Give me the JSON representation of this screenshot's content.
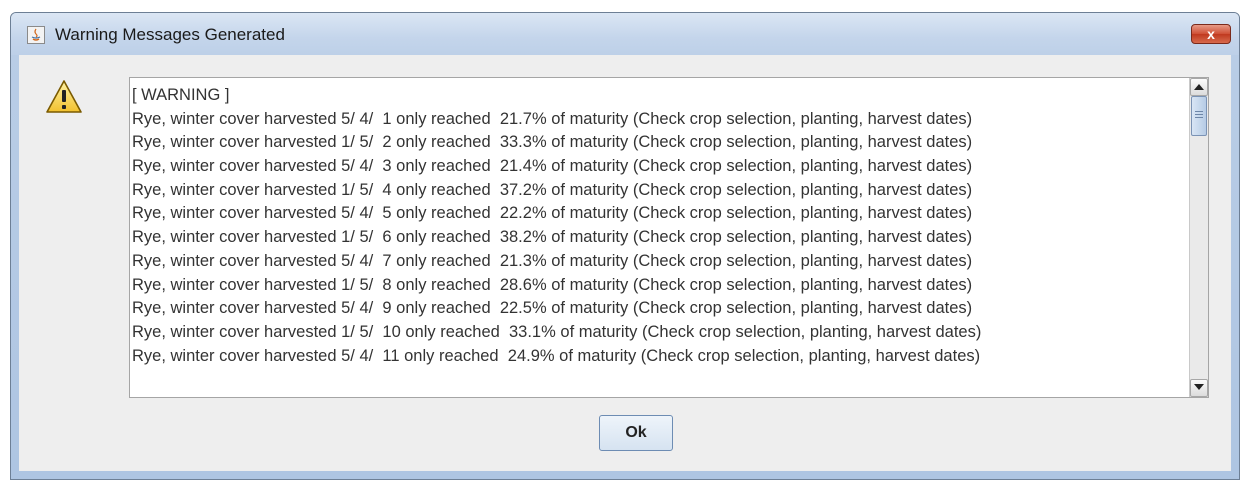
{
  "window": {
    "title": "Warning Messages Generated",
    "close_label": "x",
    "app_icon": "java-icon",
    "dialog_icon": "warning-icon"
  },
  "messages": {
    "header": "[ WARNING ]",
    "lines": [
      {
        "crop": "Rye, winter cover harvested",
        "date": "5/ 4/",
        "n": "1",
        "reached": "only reached",
        "pct": "21.7%",
        "rest": "of maturity (Check crop selection, planting, harvest dates)"
      },
      {
        "crop": "Rye, winter cover harvested",
        "date": "1/ 5/",
        "n": "2",
        "reached": "only reached",
        "pct": "33.3%",
        "rest": "of maturity (Check crop selection, planting, harvest dates)"
      },
      {
        "crop": "Rye, winter cover harvested",
        "date": "5/ 4/",
        "n": "3",
        "reached": "only reached",
        "pct": "21.4%",
        "rest": "of maturity (Check crop selection, planting, harvest dates)"
      },
      {
        "crop": "Rye, winter cover harvested",
        "date": "1/ 5/",
        "n": "4",
        "reached": "only reached",
        "pct": "37.2%",
        "rest": "of maturity (Check crop selection, planting, harvest dates)"
      },
      {
        "crop": "Rye, winter cover harvested",
        "date": "5/ 4/",
        "n": "5",
        "reached": "only reached",
        "pct": "22.2%",
        "rest": "of maturity (Check crop selection, planting, harvest dates)"
      },
      {
        "crop": "Rye, winter cover harvested",
        "date": "1/ 5/",
        "n": "6",
        "reached": "only reached",
        "pct": "38.2%",
        "rest": "of maturity (Check crop selection, planting, harvest dates)"
      },
      {
        "crop": "Rye, winter cover harvested",
        "date": "5/ 4/",
        "n": "7",
        "reached": "only reached",
        "pct": "21.3%",
        "rest": "of maturity (Check crop selection, planting, harvest dates)"
      },
      {
        "crop": "Rye, winter cover harvested",
        "date": "1/ 5/",
        "n": "8",
        "reached": "only reached",
        "pct": "28.6%",
        "rest": "of maturity (Check crop selection, planting, harvest dates)"
      },
      {
        "crop": "Rye, winter cover harvested",
        "date": "5/ 4/",
        "n": "9",
        "reached": "only reached",
        "pct": "22.5%",
        "rest": "of maturity (Check crop selection, planting, harvest dates)"
      },
      {
        "crop": "Rye, winter cover harvested",
        "date": "1/ 5/",
        "n": "10",
        "reached": "only reached",
        "pct": "33.1%",
        "rest": "of maturity (Check crop selection, planting, harvest dates)"
      },
      {
        "crop": "Rye, winter cover harvested",
        "date": "5/ 4/",
        "n": "11",
        "reached": "only reached",
        "pct": "24.9%",
        "rest": "of maturity (Check crop selection, planting, harvest dates)"
      }
    ]
  },
  "buttons": {
    "ok_label": "Ok"
  }
}
